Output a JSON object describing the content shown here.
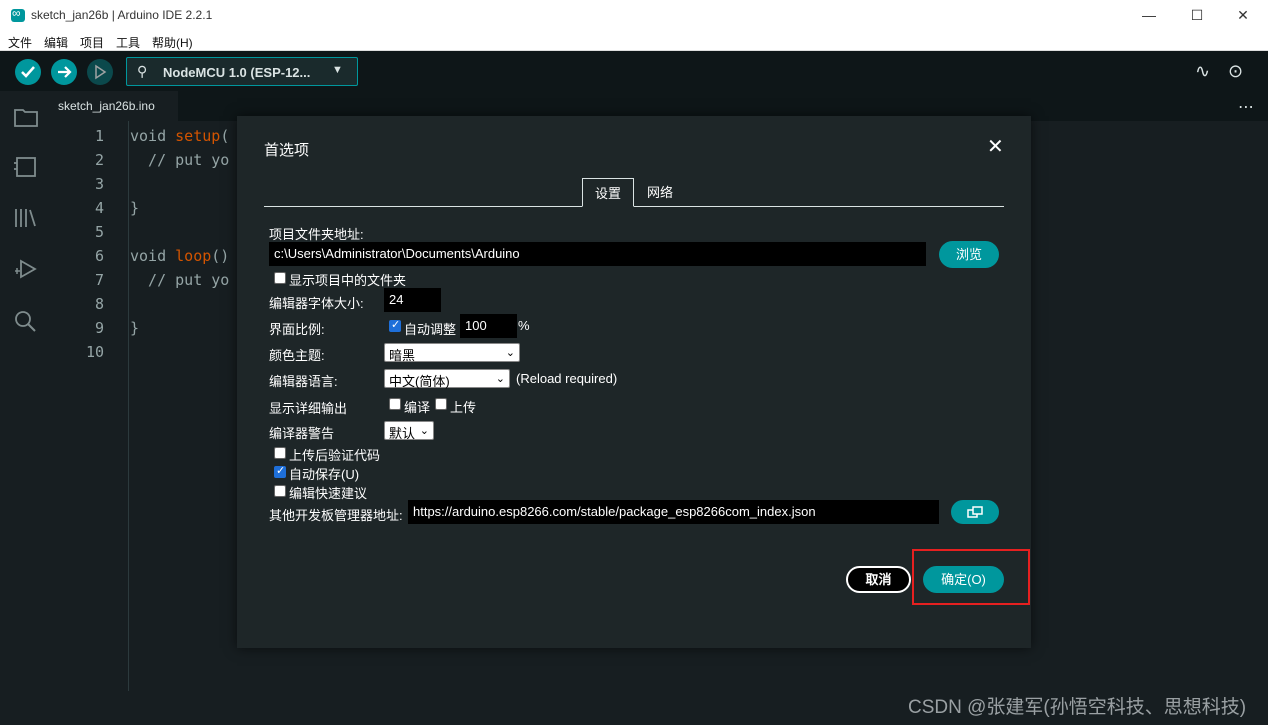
{
  "window": {
    "title": "sketch_jan26b | Arduino IDE 2.2.1",
    "minimize": "—",
    "maximize": "☐",
    "close": "✕"
  },
  "menu": [
    "文件",
    "编辑",
    "项目",
    "工具",
    "帮助(H)"
  ],
  "toolbar": {
    "board": "NodeMCU 1.0 (ESP-12...",
    "icons": [
      "verify-icon",
      "upload-icon",
      "debug-icon",
      "serial-plotter-icon",
      "serial-monitor-icon"
    ]
  },
  "editor": {
    "tab": "sketch_jan26b.ino",
    "line_numbers": [
      "1",
      "2",
      "3",
      "4",
      "5",
      "6",
      "7",
      "8",
      "9",
      "10"
    ]
  },
  "dialog": {
    "title": "首选项",
    "tabs": [
      "设置",
      "网络"
    ],
    "sketchbook_label": "项目文件夹地址:",
    "sketchbook_path": "c:\\Users\\Administrator\\Documents\\Arduino",
    "browse": "浏览",
    "show_files": "显示项目中的文件夹",
    "font_size_label": "编辑器字体大小:",
    "font_size": "24",
    "scale_label": "界面比例:",
    "auto_adjust": "自动调整",
    "scale_value": "100",
    "scale_unit": "%",
    "theme_label": "颜色主题:",
    "theme": "暗黑",
    "language_label": "编辑器语言:",
    "language": "中文(简体)",
    "reload_note": "(Reload required)",
    "verbose_label": "显示详细输出",
    "verbose_compile": "编译",
    "verbose_upload": "上传",
    "warnings_label": "编译器警告",
    "warnings": "默认",
    "verify_after_upload": "上传后验证代码",
    "auto_save": "自动保存(U)",
    "quick_suggestions": "编辑快速建议",
    "board_urls_label": "其他开发板管理器地址:",
    "board_urls": "https://arduino.esp8266.com/stable/package_esp8266com_index.json",
    "cancel": "取消",
    "ok": "确定(O)"
  },
  "watermark": "CSDN @张建军(孙悟空科技、思想科技)"
}
